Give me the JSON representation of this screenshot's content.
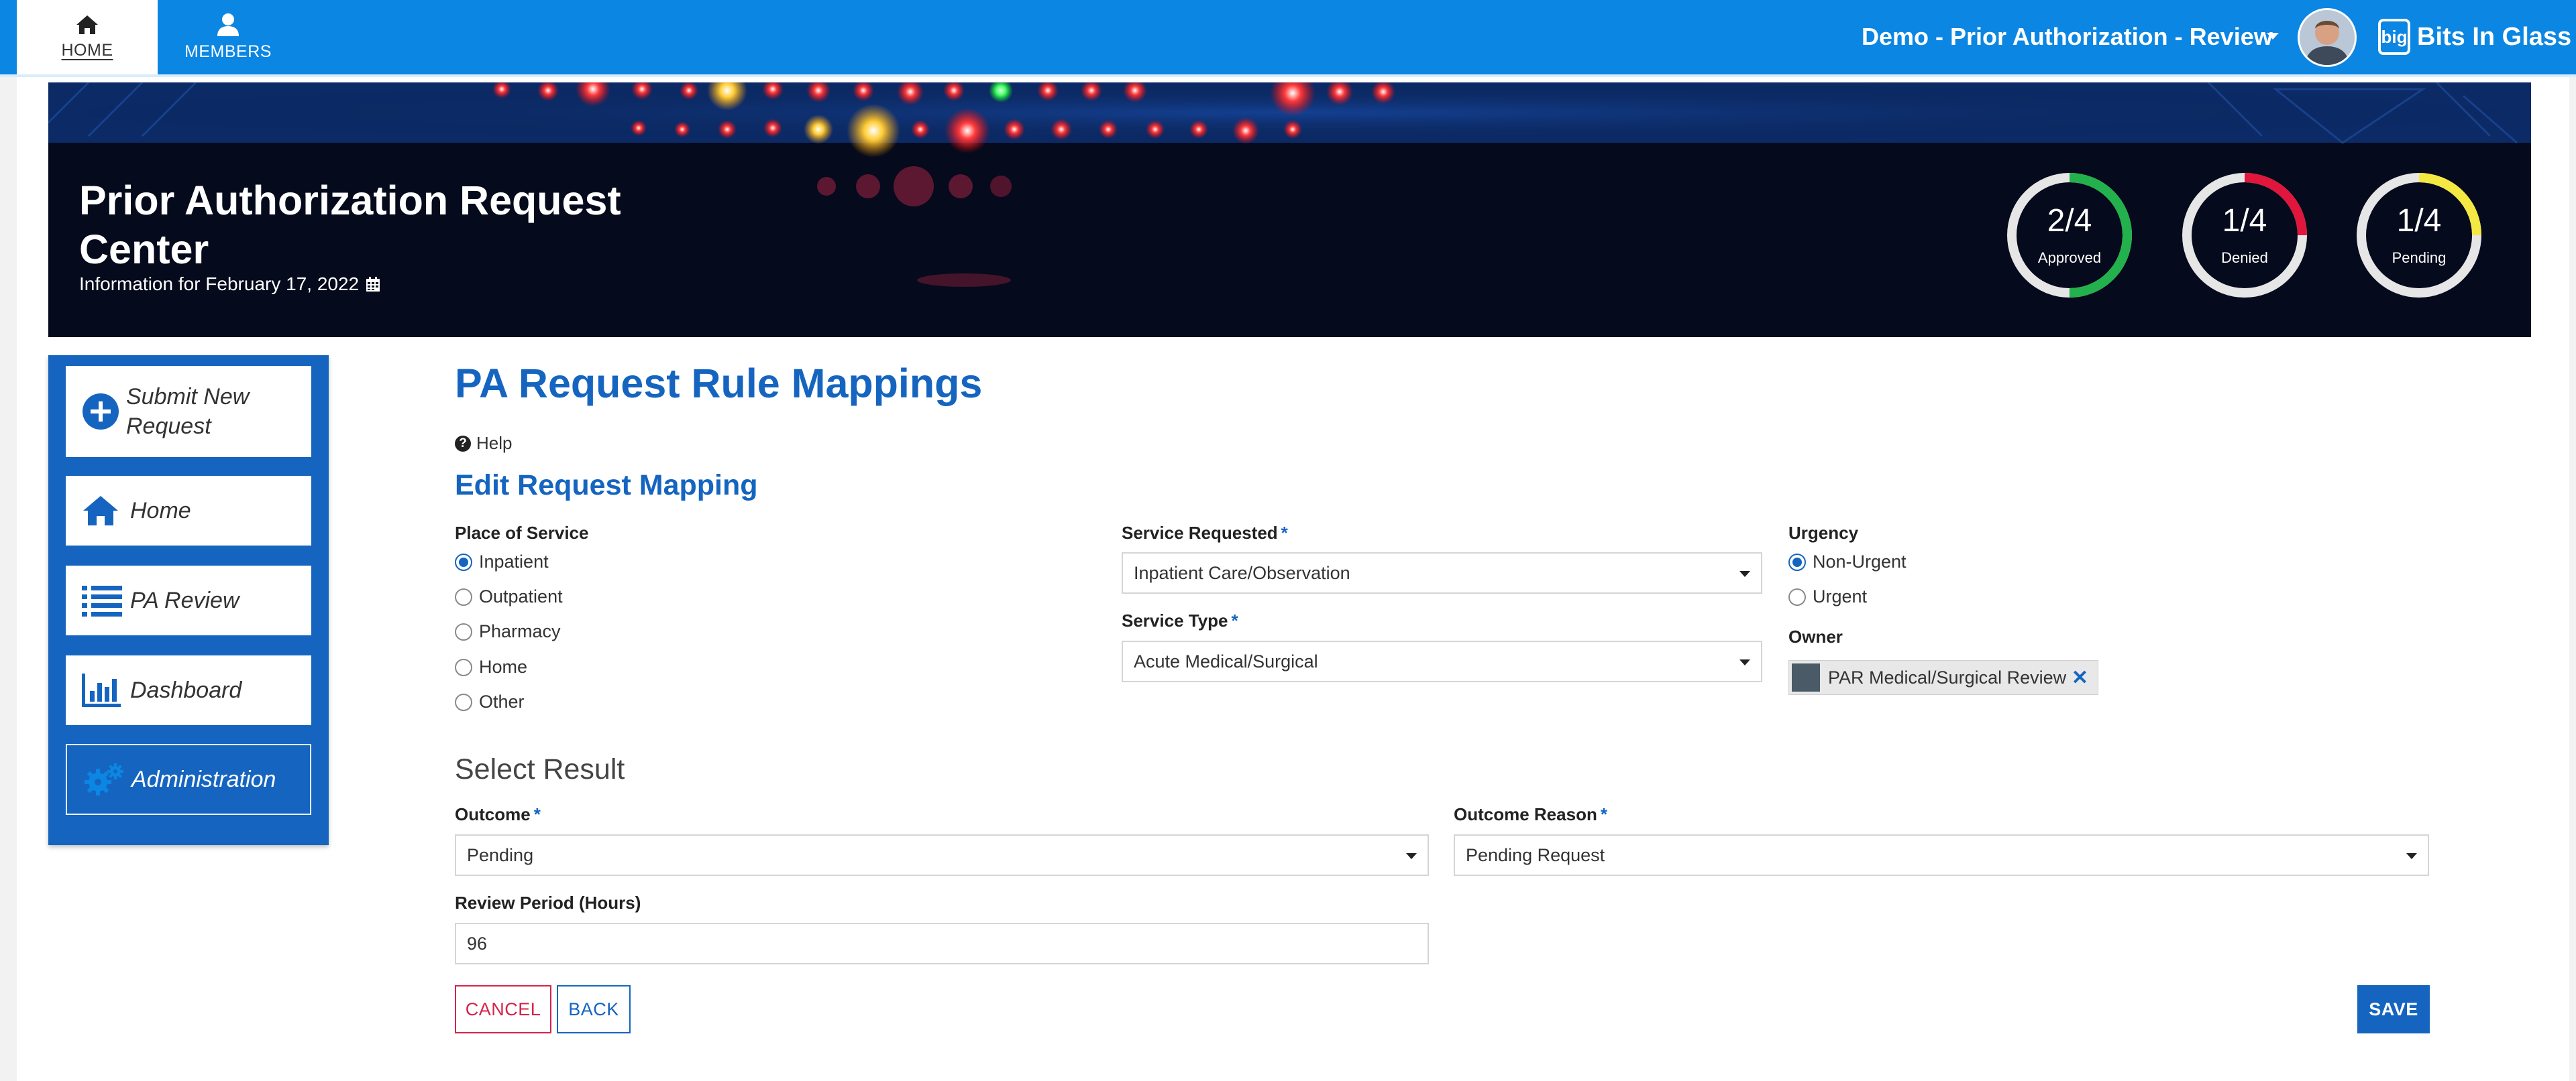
{
  "nav": {
    "tabs": [
      {
        "label": "HOME",
        "icon": "home-icon"
      },
      {
        "label": "MEMBERS",
        "icon": "user-icon"
      }
    ],
    "app_title": "Demo - Prior Authorization - Review",
    "logo_mark": "big",
    "brand": "Bits In Glass"
  },
  "banner": {
    "title": "Prior Authorization Request Center",
    "info": "Information for February 17, 2022",
    "stats": [
      {
        "value": "2/4",
        "label": "Approved",
        "fraction": 0.5,
        "color": "#22b14c"
      },
      {
        "value": "1/4",
        "label": "Denied",
        "fraction": 0.25,
        "color": "#e0163c"
      },
      {
        "value": "1/4",
        "label": "Pending",
        "fraction": 0.25,
        "color": "#f4e842"
      }
    ]
  },
  "sidebar": {
    "items": [
      {
        "label": "Submit New Request",
        "icon": "plus-circle-icon"
      },
      {
        "label": "Home",
        "icon": "home-icon"
      },
      {
        "label": "PA Review",
        "icon": "list-icon"
      },
      {
        "label": "Dashboard",
        "icon": "bar-chart-icon"
      },
      {
        "label": "Administration",
        "icon": "gears-icon"
      }
    ]
  },
  "page": {
    "title": "PA Request Rule Mappings",
    "help": "Help",
    "section_title": "Edit Request Mapping",
    "result_title": "Select Result"
  },
  "form": {
    "place_of_service": {
      "label": "Place of Service",
      "options": [
        "Inpatient",
        "Outpatient",
        "Pharmacy",
        "Home",
        "Other"
      ],
      "selected": "Inpatient"
    },
    "service_requested": {
      "label": "Service Requested",
      "required": "*",
      "value": "Inpatient Care/Observation"
    },
    "service_type": {
      "label": "Service Type",
      "required": "*",
      "value": "Acute Medical/Surgical"
    },
    "urgency": {
      "label": "Urgency",
      "options": [
        "Non-Urgent",
        "Urgent"
      ],
      "selected": "Non-Urgent"
    },
    "owner": {
      "label": "Owner",
      "value": "PAR Medical/Surgical Review",
      "remove_icon": "close-icon"
    },
    "outcome": {
      "label": "Outcome",
      "required": "*",
      "value": "Pending"
    },
    "outcome_reason": {
      "label": "Outcome Reason",
      "required": "*",
      "value": "Pending Request"
    },
    "review_period": {
      "label": "Review Period (Hours)",
      "value": "96"
    }
  },
  "actions": {
    "cancel": "CANCEL",
    "back": "BACK",
    "save": "SAVE"
  }
}
